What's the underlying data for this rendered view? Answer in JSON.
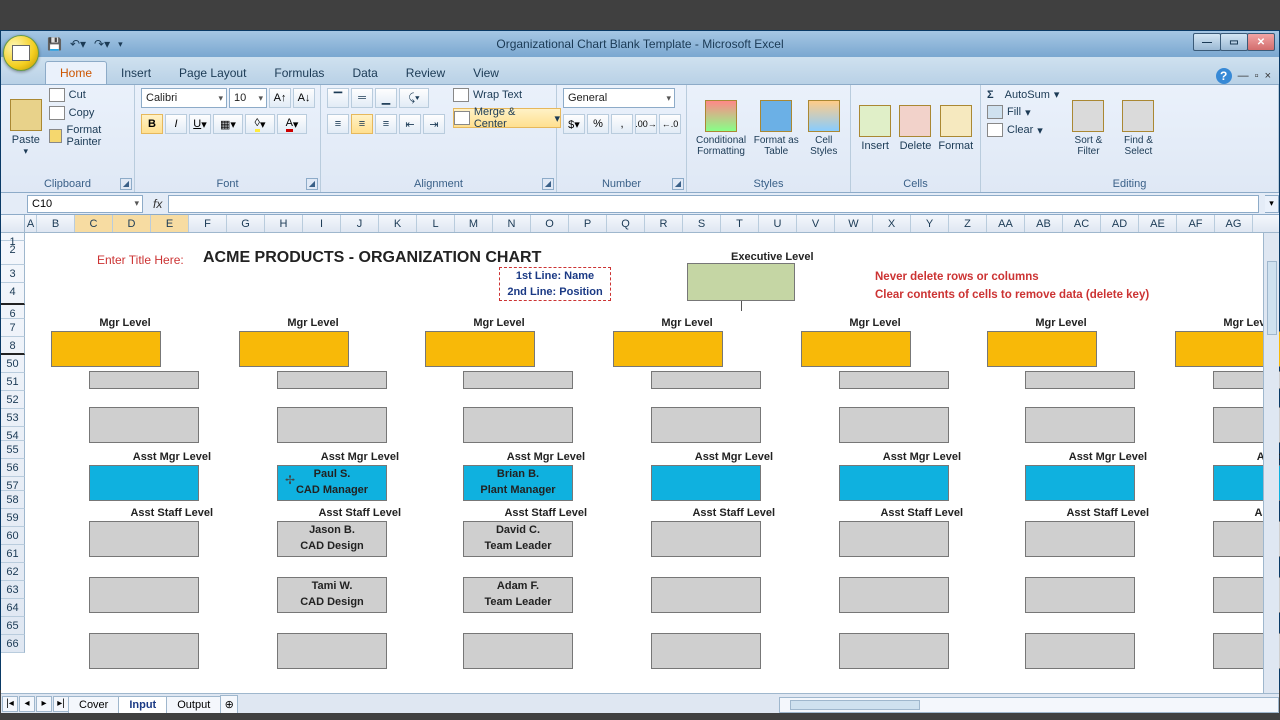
{
  "window": {
    "title": "Organizational Chart Blank Template - Microsoft Excel"
  },
  "tabs": [
    "Home",
    "Insert",
    "Page Layout",
    "Formulas",
    "Data",
    "Review",
    "View"
  ],
  "ribbon": {
    "clipboard": {
      "paste": "Paste",
      "cut": "Cut",
      "copy": "Copy",
      "fmtpaint": "Format Painter",
      "label": "Clipboard"
    },
    "font": {
      "name": "Calibri",
      "size": "10",
      "label": "Font"
    },
    "alignment": {
      "wrap": "Wrap Text",
      "merge": "Merge & Center",
      "label": "Alignment"
    },
    "number": {
      "fmt": "General",
      "label": "Number"
    },
    "styles": {
      "cf": "Conditional Formatting",
      "fat": "Format as Table",
      "cs": "Cell Styles",
      "label": "Styles"
    },
    "cells": {
      "ins": "Insert",
      "del": "Delete",
      "fmt": "Format",
      "label": "Cells"
    },
    "editing": {
      "sum": "AutoSum",
      "fill": "Fill",
      "clear": "Clear",
      "sort": "Sort & Filter",
      "find": "Find & Select",
      "label": "Editing"
    }
  },
  "namebox": "C10",
  "columns": [
    "A",
    "B",
    "C",
    "D",
    "E",
    "F",
    "G",
    "H",
    "I",
    "J",
    "K",
    "L",
    "M",
    "N",
    "O",
    "P",
    "Q",
    "R",
    "S",
    "T",
    "U",
    "V",
    "W",
    "X",
    "Y",
    "Z",
    "AA",
    "AB",
    "AC",
    "AD",
    "AE",
    "AF",
    "AG"
  ],
  "rows_top": [
    "1",
    "2",
    "3",
    "4"
  ],
  "rows": [
    "6",
    "7",
    "8",
    "50",
    "51",
    "52",
    "53",
    "54",
    "55",
    "56",
    "57",
    "58",
    "59",
    "60",
    "61",
    "62",
    "63",
    "64",
    "65",
    "66"
  ],
  "sheet": {
    "enter_title": "Enter Title Here:",
    "title": "ACME PRODUCTS - ORGANIZATION CHART",
    "legend1": "1st Line: Name",
    "legend2": "2nd Line: Position",
    "exec": "Executive Level",
    "warn1": "Never delete rows or columns",
    "warn2": "Clear contents of cells to remove data (delete key)",
    "mgr": "Mgr Level",
    "asstmgr": "Asst Mgr Level",
    "asststaff": "Asst Staff Level",
    "p2name": "Paul S.",
    "p2pos": "CAD Manager",
    "p3name": "Brian B.",
    "p3pos": "Plant Manager",
    "s2a_n": "Jason B.",
    "s2a_p": "CAD Design",
    "s2b_n": "Tami W.",
    "s2b_p": "CAD Design",
    "s3a_n": "David C.",
    "s3a_p": "Team Leader",
    "s3b_n": "Adam F.",
    "s3b_p": "Team Leader"
  },
  "sheettabs": [
    "Cover",
    "Input",
    "Output"
  ]
}
